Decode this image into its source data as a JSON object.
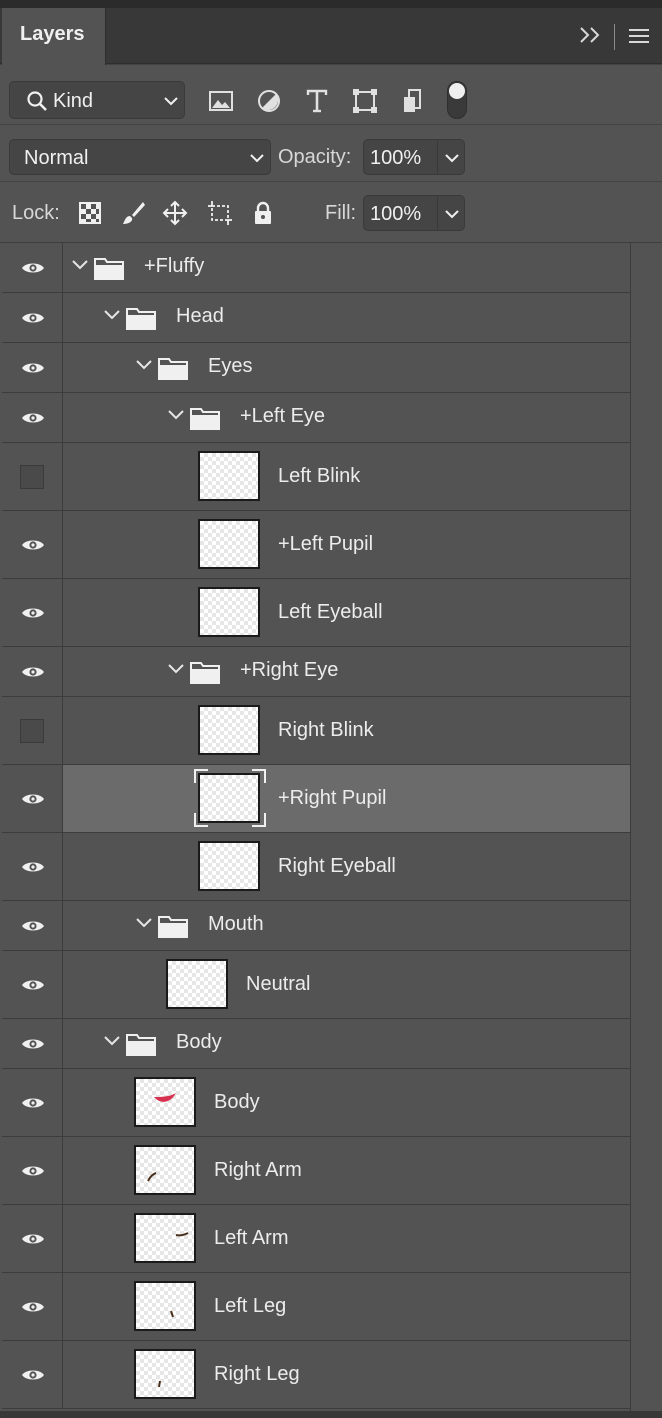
{
  "panel": {
    "tab_label": "Layers"
  },
  "filter": {
    "kind_label": "Kind"
  },
  "blend": {
    "mode": "Normal",
    "opacity_label": "Opacity:",
    "opacity_value": "100%"
  },
  "lock": {
    "lock_label": "Lock:",
    "fill_label": "Fill:",
    "fill_value": "100%"
  },
  "layers": [
    {
      "name": "+Fluffy",
      "kind": "group",
      "depth": 0,
      "visible": true
    },
    {
      "name": "Head",
      "kind": "group",
      "depth": 1,
      "visible": true
    },
    {
      "name": "Eyes",
      "kind": "group",
      "depth": 2,
      "visible": true
    },
    {
      "name": "+Left Eye",
      "kind": "group",
      "depth": 3,
      "visible": true
    },
    {
      "name": "Left Blink",
      "kind": "pixel",
      "depth": 4,
      "visible": false
    },
    {
      "name": "+Left Pupil",
      "kind": "pixel",
      "depth": 4,
      "visible": true
    },
    {
      "name": "Left Eyeball",
      "kind": "pixel",
      "depth": 4,
      "visible": true
    },
    {
      "name": "+Right Eye",
      "kind": "group",
      "depth": 3,
      "visible": true
    },
    {
      "name": "Right Blink",
      "kind": "pixel",
      "depth": 4,
      "visible": false
    },
    {
      "name": "+Right Pupil",
      "kind": "pixel",
      "depth": 4,
      "visible": true,
      "selected": true
    },
    {
      "name": "Right Eyeball",
      "kind": "pixel",
      "depth": 4,
      "visible": true
    },
    {
      "name": "Mouth",
      "kind": "group",
      "depth": 2,
      "visible": true
    },
    {
      "name": "Neutral",
      "kind": "pixel",
      "depth": 3,
      "visible": true
    },
    {
      "name": "Body",
      "kind": "group",
      "depth": 1,
      "visible": true
    },
    {
      "name": "Body",
      "kind": "pixel",
      "depth": 2,
      "visible": true,
      "thumb": "body"
    },
    {
      "name": "Right Arm",
      "kind": "pixel",
      "depth": 2,
      "visible": true,
      "thumb": "right-arm"
    },
    {
      "name": "Left Arm",
      "kind": "pixel",
      "depth": 2,
      "visible": true,
      "thumb": "left-arm"
    },
    {
      "name": "Left Leg",
      "kind": "pixel",
      "depth": 2,
      "visible": true,
      "thumb": "left-leg"
    },
    {
      "name": "Right Leg",
      "kind": "pixel",
      "depth": 2,
      "visible": true,
      "thumb": "right-leg"
    }
  ],
  "colors": {
    "panel_bg": "#535353",
    "selected_row": "#6b6b6b",
    "body_thumb_red": "#d8314f"
  }
}
